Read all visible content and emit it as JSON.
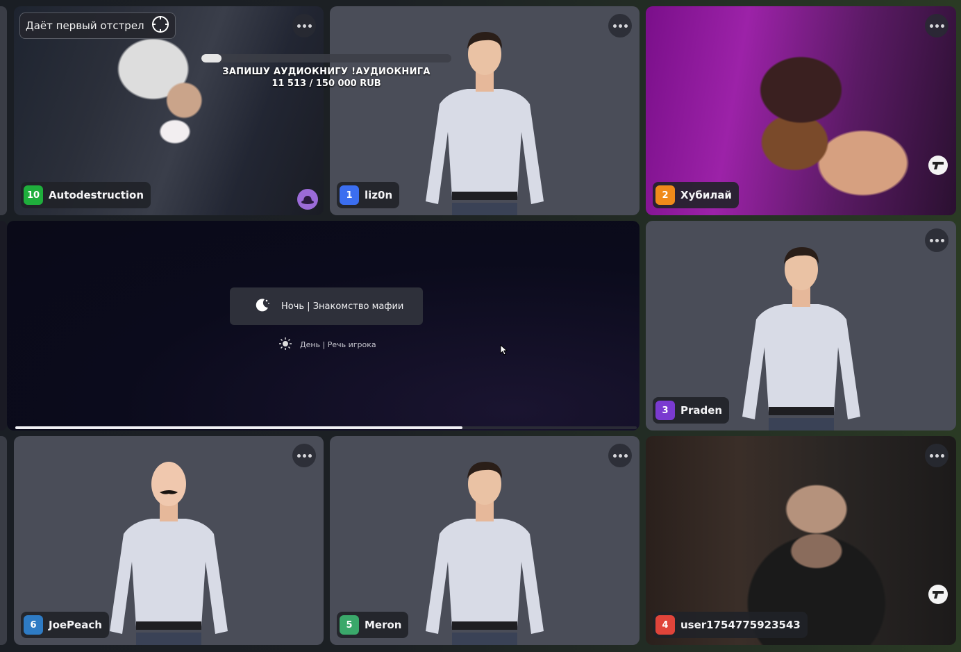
{
  "tiles": [
    {
      "id": "autodestruction",
      "number": "10",
      "name": "Autodestruction",
      "number_color": "#1fae3c"
    },
    {
      "id": "lizon",
      "number": "1",
      "name": "liz0n",
      "number_color": "#3b6ef0"
    },
    {
      "id": "hubilai",
      "number": "2",
      "name": "Хубилай",
      "number_color": "#f08a1a"
    },
    {
      "id": "praden",
      "number": "3",
      "name": "Praden",
      "number_color": "#7a3ad0"
    },
    {
      "id": "joepeach",
      "number": "6",
      "name": "JoePeach",
      "number_color": "#2e7bc4"
    },
    {
      "id": "meron",
      "number": "5",
      "name": "Meron",
      "number_color": "#3aa86a"
    },
    {
      "id": "user",
      "number": "4",
      "name": "user1754775923543",
      "number_color": "#e0443a"
    }
  ],
  "shot_tag": {
    "label": "Даёт первый отстрел"
  },
  "donation": {
    "title": "ЗАПИШУ АУДИОКНИГУ !АУДИОКНИГА",
    "amount": "11 513 / 150 000 RUB",
    "progress": 0.0768
  },
  "phase": {
    "current": "Ночь | Знакомство мафии",
    "next": "День | Речь игрока",
    "progress": 0.72
  },
  "icons": {
    "more": "more-dots-icon",
    "crosshair": "crosshair-icon",
    "moon": "moon-icon",
    "sun": "sun-icon",
    "gun": "gun-icon",
    "hat": "hat-icon",
    "cursor": "mouse-cursor-icon"
  }
}
